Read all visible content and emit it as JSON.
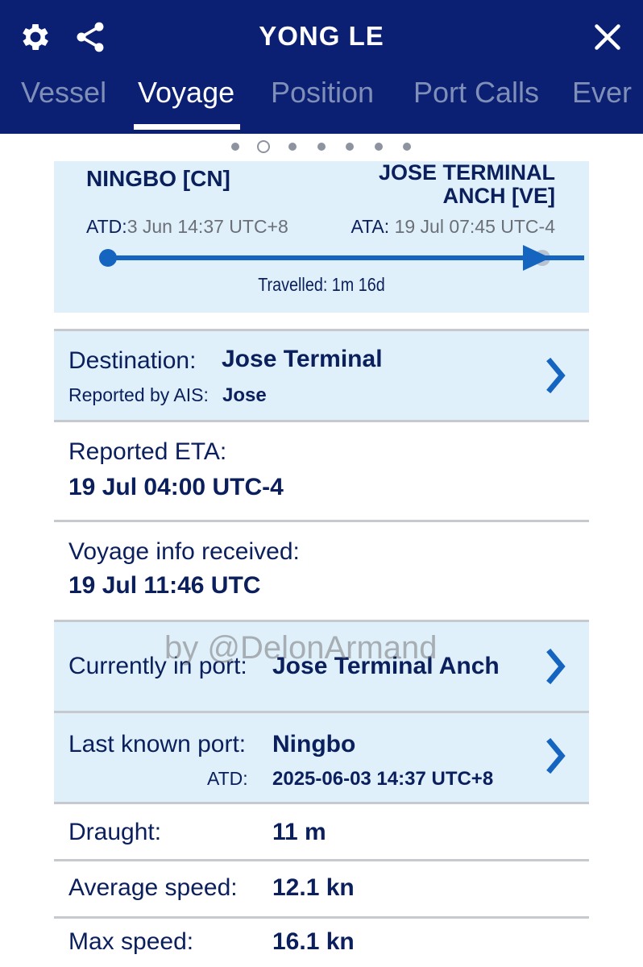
{
  "header": {
    "title": "YONG LE",
    "icons": {
      "settings": "gear-icon",
      "share": "share-icon",
      "close": "close-icon"
    },
    "tabs": [
      {
        "label": "Vessel",
        "active": false
      },
      {
        "label": "Voyage",
        "active": true
      },
      {
        "label": "Position",
        "active": false
      },
      {
        "label": "Port Calls",
        "active": false
      },
      {
        "label": "Ever",
        "active": false
      }
    ],
    "colors": {
      "background": "#0b1f73",
      "active_tab": "#ffffff",
      "inactive_tab": "#7f8fb8"
    }
  },
  "pager": {
    "count": 7,
    "current_index": 1
  },
  "route": {
    "origin": "NINGBO [CN]",
    "destination_line1": "JOSE TERMINAL",
    "destination_line2": "ANCH [VE]",
    "atd_label": "ATD:",
    "atd_value": "3 Jun 14:37 UTC+8",
    "ata_label": "ATA:",
    "ata_value": "19 Jul 07:45 UTC-4",
    "travelled": "Travelled: 1m 16d",
    "progress": 1.0
  },
  "destination": {
    "label": "Destination:",
    "value": "Jose Terminal",
    "ais_label": "Reported by AIS:",
    "ais_value": "Jose"
  },
  "eta": {
    "label": "Reported ETA:",
    "value": "19 Jul 04:00 UTC-4"
  },
  "voyage_info": {
    "label": "Voyage info received:",
    "value": "19 Jul 11:46 UTC"
  },
  "current_port": {
    "label": "Currently in port:",
    "value": "Jose Terminal Anch"
  },
  "last_port": {
    "label": "Last known port:",
    "value": "Ningbo",
    "atd_label": "ATD:",
    "atd_value": "2025-06-03 14:37 UTC+8"
  },
  "draught": {
    "label": "Draught:",
    "value": "11 m"
  },
  "avg_speed": {
    "label": "Average speed:",
    "value": "12.1 kn"
  },
  "max_speed": {
    "label": "Max speed:",
    "value": "16.1 kn"
  },
  "watermark": "by @DelonArmand",
  "colors": {
    "accent": "#1565c0",
    "card": "#dff0fb",
    "text": "#0a1f5c"
  }
}
